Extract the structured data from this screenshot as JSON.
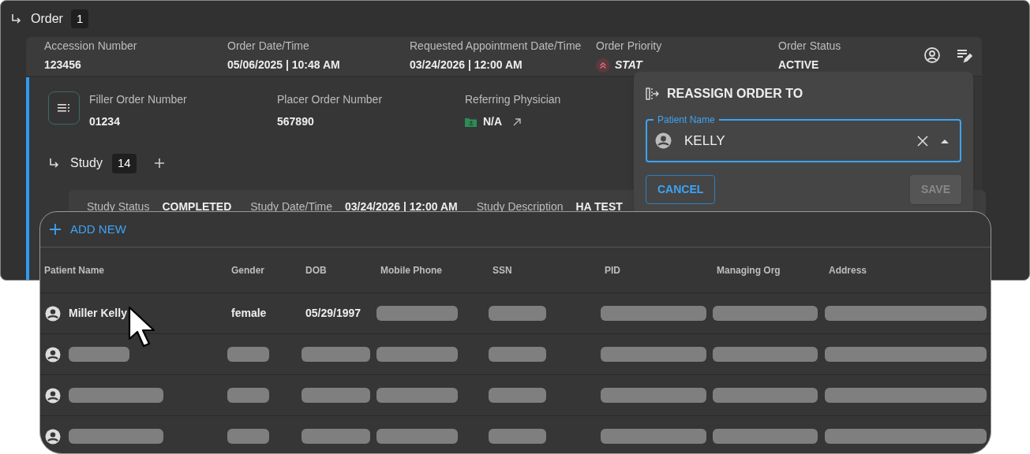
{
  "order_header": {
    "title": "Order",
    "count": "1"
  },
  "order_fields": [
    {
      "label": "Accession Number",
      "value": "123456",
      "kind": "plain"
    },
    {
      "label": "Order Date/Time",
      "value": "05/06/2025 | 10:48 AM",
      "kind": "plain"
    },
    {
      "label": "Requested Appointment Date/Time",
      "value": "03/24/2026 | 12:00 AM",
      "kind": "plain"
    },
    {
      "label": "Order Priority",
      "value": "STAT",
      "kind": "priority"
    },
    {
      "label": "Order Status",
      "value": "ACTIVE",
      "kind": "plain"
    }
  ],
  "detail_fields": [
    {
      "label": "Filler Order Number",
      "value": "01234",
      "kind": "plain"
    },
    {
      "label": "Placer Order Number",
      "value": "567890",
      "kind": "plain"
    },
    {
      "label": "Referring Physician",
      "value": "N/A",
      "kind": "physician"
    }
  ],
  "study_header": {
    "title": "Study",
    "count": "14"
  },
  "study_fields": [
    {
      "label": "Study Status",
      "value": "COMPLETED"
    },
    {
      "label": "Study Date/Time",
      "value": "03/24/2026 | 12:00 AM"
    },
    {
      "label": "Study Description",
      "value": "HA TEST"
    }
  ],
  "popover": {
    "title": "REASSIGN ORDER TO",
    "field_label": "Patient Name",
    "field_value": "KELLY",
    "focused": true,
    "buttons": [
      {
        "label": "CANCEL",
        "kind": "outlined",
        "disabled": false
      },
      {
        "label": "SAVE",
        "kind": "contained",
        "disabled": true
      }
    ]
  },
  "table": {
    "add_new": "ADD NEW",
    "columns": [
      "Patient Name",
      "Gender",
      "DOB",
      "Mobile Phone",
      "SSN",
      "PID",
      "Managing Org",
      "Address"
    ],
    "rows": [
      {
        "cells": [
          {
            "kind": "text",
            "text": "Miller Kelly"
          },
          {
            "kind": "text",
            "text": "female"
          },
          {
            "kind": "text",
            "text": "05/29/1997"
          },
          {
            "kind": "redacted"
          },
          {
            "kind": "redacted"
          },
          {
            "kind": "redacted"
          },
          {
            "kind": "redacted"
          },
          {
            "kind": "redacted"
          }
        ]
      },
      {
        "cells": [
          {
            "kind": "redacted"
          },
          {
            "kind": "redacted"
          },
          {
            "kind": "redacted"
          },
          {
            "kind": "redacted"
          },
          {
            "kind": "redacted"
          },
          {
            "kind": "redacted"
          },
          {
            "kind": "redacted"
          },
          {
            "kind": "redacted"
          }
        ]
      },
      {
        "cells": [
          {
            "kind": "redacted"
          },
          {
            "kind": "redacted"
          },
          {
            "kind": "redacted"
          },
          {
            "kind": "redacted"
          },
          {
            "kind": "redacted"
          },
          {
            "kind": "redacted"
          },
          {
            "kind": "redacted"
          },
          {
            "kind": "redacted"
          }
        ]
      },
      {
        "cells": [
          {
            "kind": "redacted"
          },
          {
            "kind": "redacted"
          },
          {
            "kind": "redacted"
          },
          {
            "kind": "redacted"
          },
          {
            "kind": "redacted"
          },
          {
            "kind": "redacted"
          },
          {
            "kind": "redacted"
          },
          {
            "kind": "redacted"
          }
        ]
      }
    ]
  }
}
